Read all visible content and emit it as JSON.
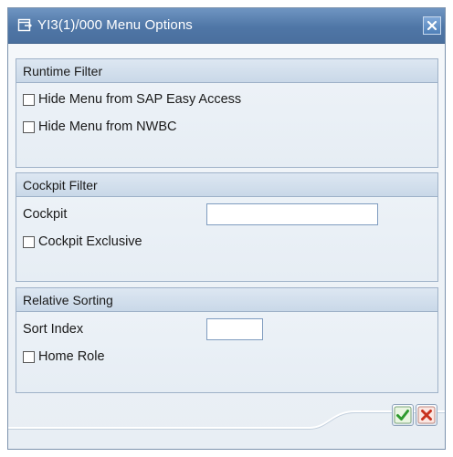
{
  "window": {
    "title": "YI3(1)/000 Menu Options",
    "title_icon": "window-icon",
    "close_icon": "close-icon"
  },
  "runtime_filter": {
    "header": "Runtime Filter",
    "hide_easy_access_label": "Hide Menu from SAP Easy Access",
    "hide_easy_access_checked": false,
    "hide_nwbc_label": "Hide Menu from NWBC",
    "hide_nwbc_checked": false
  },
  "cockpit_filter": {
    "header": "Cockpit Filter",
    "cockpit_label": "Cockpit",
    "cockpit_value": "",
    "exclusive_label": "Cockpit Exclusive",
    "exclusive_checked": false
  },
  "relative_sorting": {
    "header": "Relative Sorting",
    "sort_index_label": "Sort Index",
    "sort_index_value": "",
    "home_role_label": "Home Role",
    "home_role_checked": false
  },
  "footer": {
    "confirm_icon": "checkmark-icon",
    "cancel_icon": "cancel-x-icon"
  },
  "colors": {
    "titlebar": "#4f76a6",
    "confirm_green": "#2e9a2e",
    "cancel_red": "#c8321e"
  }
}
